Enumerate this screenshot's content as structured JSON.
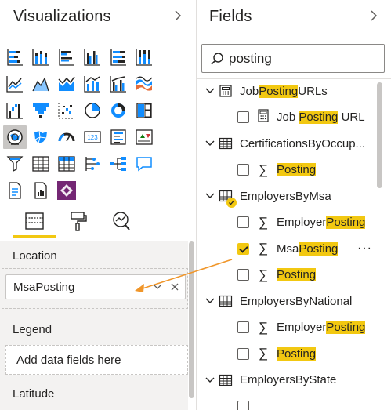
{
  "visualizations": {
    "title": "Visualizations",
    "collapse_icon": "chevron-right-icon",
    "icons": [
      "stacked-bar-chart-icon",
      "stacked-column-chart-icon",
      "clustered-bar-chart-icon",
      "clustered-column-chart-icon",
      "100-stacked-bar-chart-icon",
      "100-stacked-column-chart-icon",
      "line-chart-icon",
      "area-chart-icon",
      "stacked-area-chart-icon",
      "line-and-stacked-column-chart-icon",
      "line-and-clustered-column-chart-icon",
      "ribbon-chart-icon",
      "waterfall-chart-icon",
      "funnel-icon",
      "scatter-chart-icon",
      "pie-chart-icon",
      "donut-chart-icon",
      "treemap-icon",
      "map-icon",
      "filled-map-icon",
      "gauge-icon",
      "card-icon",
      "multi-row-card-icon",
      "kpi-icon",
      "slicer-icon",
      "table-icon",
      "matrix-icon",
      "key-influencers-icon",
      "decomposition-tree-icon",
      "qa-icon",
      "smart-narrative-icon",
      "paginated-report-icon",
      "power-apps-icon"
    ],
    "selected_icon": "map-icon",
    "tabs": [
      "fields-tab-icon",
      "format-tab-icon",
      "analytics-tab-icon"
    ],
    "wells": {
      "location": {
        "label": "Location",
        "value": "MsaPosting"
      },
      "legend": {
        "label": "Legend",
        "placeholder": "Add data fields here"
      },
      "latitude": {
        "label": "Latitude"
      }
    }
  },
  "fields": {
    "title": "Fields",
    "collapse_icon": "chevron-right-icon",
    "search": {
      "value": "posting"
    },
    "tables": [
      {
        "name_parts": [
          "Job",
          "Posting",
          "URLs"
        ],
        "icon": "calculator-table-icon",
        "fields": [
          {
            "parts": [
              "Job ",
              "Posting",
              " URL"
            ],
            "icon": "calculator-icon",
            "checked": false
          }
        ]
      },
      {
        "name_parts": [
          "CertificationsByOccup...",
          "",
          ""
        ],
        "icon": "table-icon",
        "fields": [
          {
            "parts": [
              "",
              "Posting",
              ""
            ],
            "icon": "sigma-icon",
            "checked": false
          }
        ]
      },
      {
        "name_parts": [
          "EmployersByMsa",
          "",
          ""
        ],
        "icon": "table-icon",
        "badge": true,
        "fields": [
          {
            "parts": [
              "Employer",
              "Posting",
              ""
            ],
            "icon": "sigma-icon",
            "checked": false
          },
          {
            "parts": [
              "Msa",
              "Posting",
              ""
            ],
            "icon": "sigma-icon",
            "checked": true,
            "more": "···"
          },
          {
            "parts": [
              "",
              "Posting",
              ""
            ],
            "icon": "sigma-icon",
            "checked": false
          }
        ]
      },
      {
        "name_parts": [
          "EmployersByNational",
          "",
          ""
        ],
        "icon": "table-icon",
        "fields": [
          {
            "parts": [
              "Employer",
              "Posting",
              ""
            ],
            "icon": "sigma-icon",
            "checked": false
          },
          {
            "parts": [
              "",
              "Posting",
              ""
            ],
            "icon": "sigma-icon",
            "checked": false
          }
        ]
      },
      {
        "name_parts": [
          "EmployersByState",
          "",
          ""
        ],
        "icon": "table-icon",
        "fields": []
      }
    ]
  }
}
